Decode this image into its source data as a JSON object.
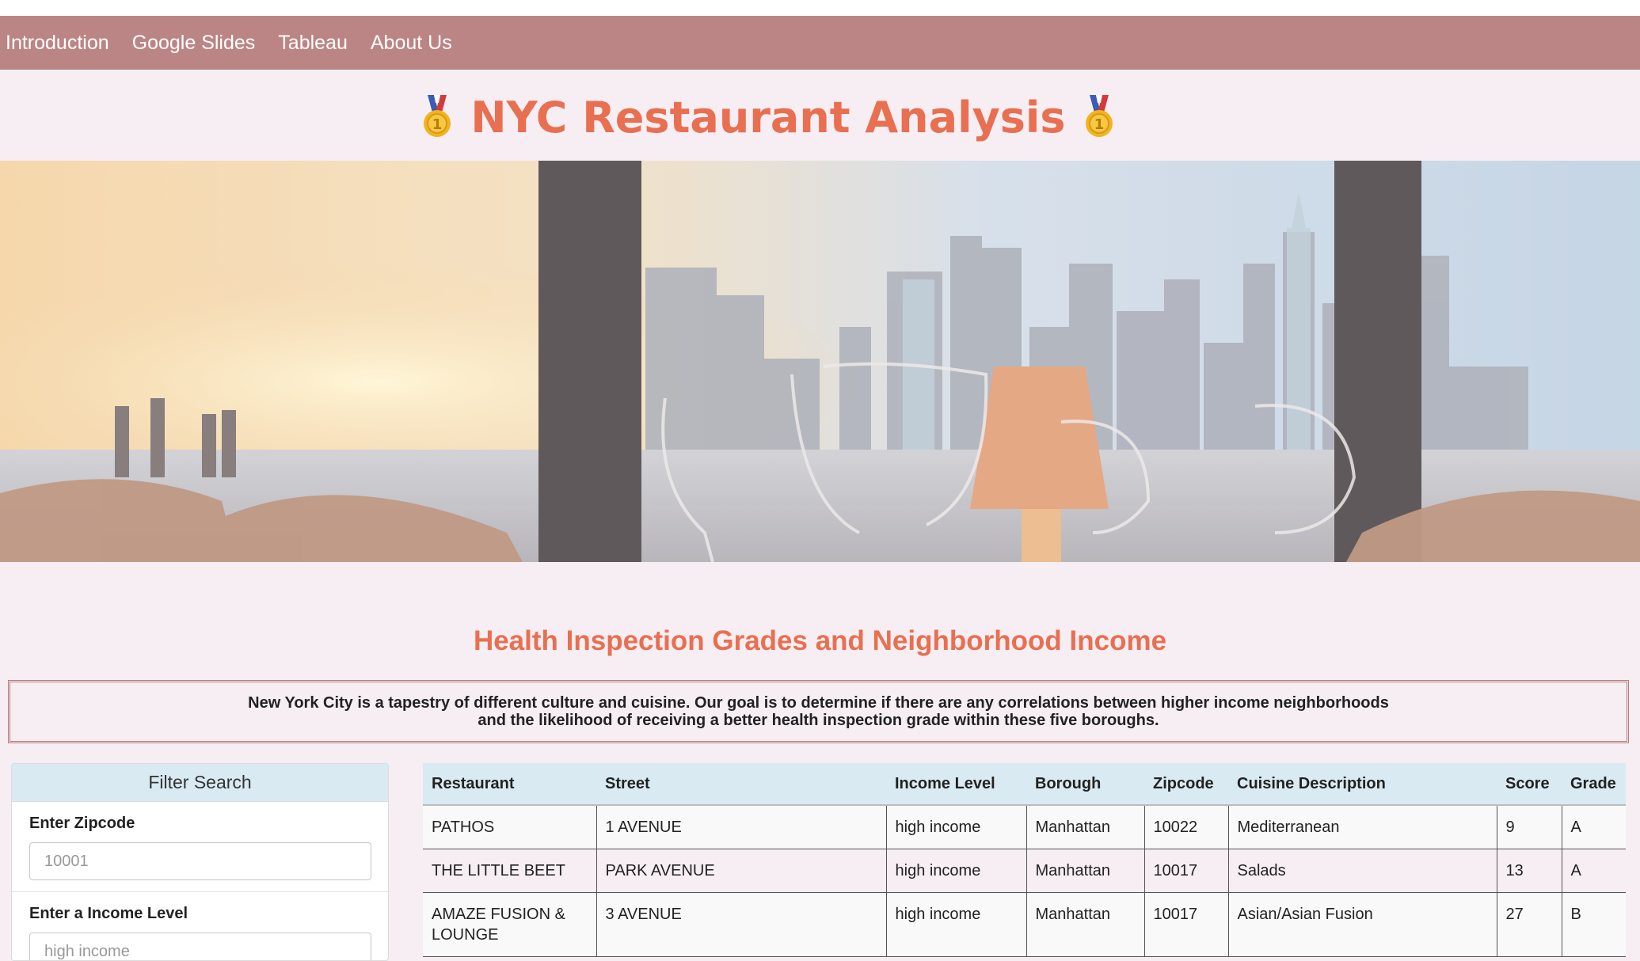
{
  "nav": {
    "items": [
      {
        "label": "Introduction"
      },
      {
        "label": "Google Slides"
      },
      {
        "label": "Tableau"
      },
      {
        "label": "About Us"
      }
    ]
  },
  "header": {
    "title": "NYC Restaurant Analysis",
    "icon_left": "first-place-medal-icon",
    "icon_right": "first-place-medal-icon"
  },
  "hero": {
    "image": "restaurant-window-skyline-photo"
  },
  "section": {
    "title": "Health Inspection Grades and Neighborhood Income",
    "intro": "New York City is a tapestry of different culture and cuisine. Our goal is to determine if there are any correlations between higher income neighborhoods and the likelihood of receiving a better health inspection grade within these five boroughs."
  },
  "filters": {
    "header": "Filter Search",
    "zipcode": {
      "label": "Enter Zipcode",
      "placeholder": "10001"
    },
    "income": {
      "label": "Enter a Income Level",
      "placeholder": "high income"
    }
  },
  "table": {
    "columns": [
      "Restaurant",
      "Street",
      "Income Level",
      "Borough",
      "Zipcode",
      "Cuisine Description",
      "Score",
      "Grade"
    ],
    "rows": [
      [
        "PATHOS",
        "1 AVENUE",
        "high income",
        "Manhattan",
        "10022",
        "Mediterranean",
        "9",
        "A"
      ],
      [
        "THE LITTLE BEET",
        "PARK AVENUE",
        "high income",
        "Manhattan",
        "10017",
        "Salads",
        "13",
        "A"
      ],
      [
        "AMAZE FUSION & LOUNGE",
        "3 AVENUE",
        "high income",
        "Manhattan",
        "10017",
        "Asian/Asian Fusion",
        "27",
        "B"
      ]
    ]
  },
  "colors": {
    "navbar": "#bc8585",
    "accent": "#e96f51",
    "table_header": "#d9eaf3",
    "page_background": "#f6eef2"
  }
}
